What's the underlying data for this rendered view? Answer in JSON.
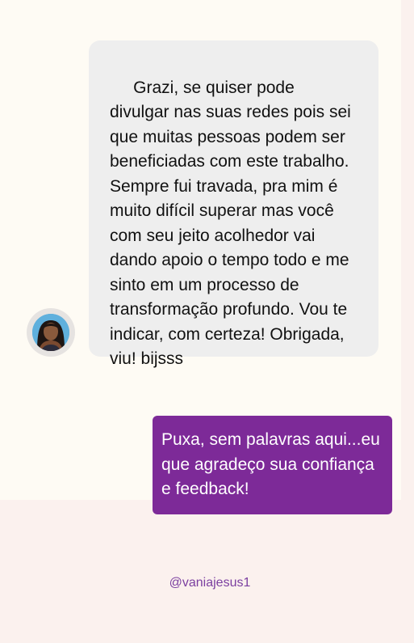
{
  "conversation": {
    "received_message": " Grazi, se quiser pode divulgar nas suas redes pois sei que muitas pessoas podem ser beneficiadas com este trabalho. Sempre fui travada, pra mim é muito difícil superar mas você com seu jeito acolhedor vai dando apoio o tempo todo e me sinto em um processo de transformação profundo. Vou te indicar, com certeza! Obrigada, viu! bijsss",
    "sent_message": "Puxa, sem palavras aqui...eu que agradeço sua confiança e feedback!"
  },
  "footer": {
    "handle": "@vaniajesus1"
  },
  "colors": {
    "page_background": "#fbf1ee",
    "panel_background": "#fefbf4",
    "received_bubble": "#eeeeee",
    "sent_bubble": "#7d2a98",
    "handle_text": "#7b3fa0"
  }
}
